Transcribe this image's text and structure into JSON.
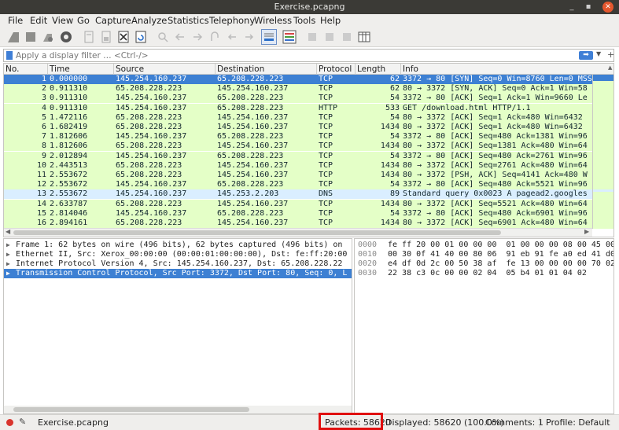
{
  "window": {
    "title": "Exercise.pcapng",
    "min": "_",
    "max": "▪",
    "close": "✕"
  },
  "menu": [
    "File",
    "Edit",
    "View",
    "Go",
    "Capture",
    "Analyze",
    "Statistics",
    "Telephony",
    "Wireless",
    "Tools",
    "Help"
  ],
  "filter": {
    "placeholder": "Apply a display filter … <Ctrl-/>"
  },
  "columns": [
    "No.",
    "Time",
    "Source",
    "Destination",
    "Protocol",
    "Length",
    "Info"
  ],
  "packets": [
    {
      "no": "1",
      "time": "0.000000",
      "src": "145.254.160.237",
      "dst": "65.208.228.223",
      "proto": "TCP",
      "len": "62",
      "info": "3372 → 80 [SYN] Seq=0 Win=8760 Len=0 MSS",
      "cls": "sel"
    },
    {
      "no": "2",
      "time": "0.911310",
      "src": "65.208.228.223",
      "dst": "145.254.160.237",
      "proto": "TCP",
      "len": "62",
      "info": "80 → 3372 [SYN, ACK] Seq=0 Ack=1 Win=58",
      "cls": "tcp"
    },
    {
      "no": "3",
      "time": "0.911310",
      "src": "145.254.160.237",
      "dst": "65.208.228.223",
      "proto": "TCP",
      "len": "54",
      "info": "3372 → 80 [ACK] Seq=1 Ack=1 Win=9660 Le",
      "cls": "tcp"
    },
    {
      "no": "4",
      "time": "0.911310",
      "src": "145.254.160.237",
      "dst": "65.208.228.223",
      "proto": "HTTP",
      "len": "533",
      "info": "GET /download.html HTTP/1.1",
      "cls": "http"
    },
    {
      "no": "5",
      "time": "1.472116",
      "src": "65.208.228.223",
      "dst": "145.254.160.237",
      "proto": "TCP",
      "len": "54",
      "info": "80 → 3372 [ACK] Seq=1 Ack=480 Win=6432",
      "cls": "tcp"
    },
    {
      "no": "6",
      "time": "1.682419",
      "src": "65.208.228.223",
      "dst": "145.254.160.237",
      "proto": "TCP",
      "len": "1434",
      "info": "80 → 3372 [ACK] Seq=1 Ack=480 Win=6432",
      "cls": "tcp"
    },
    {
      "no": "7",
      "time": "1.812606",
      "src": "145.254.160.237",
      "dst": "65.208.228.223",
      "proto": "TCP",
      "len": "54",
      "info": "3372 → 80 [ACK] Seq=480 Ack=1381 Win=96",
      "cls": "tcp"
    },
    {
      "no": "8",
      "time": "1.812606",
      "src": "65.208.228.223",
      "dst": "145.254.160.237",
      "proto": "TCP",
      "len": "1434",
      "info": "80 → 3372 [ACK] Seq=1381 Ack=480 Win=64",
      "cls": "tcp"
    },
    {
      "no": "9",
      "time": "2.012894",
      "src": "145.254.160.237",
      "dst": "65.208.228.223",
      "proto": "TCP",
      "len": "54",
      "info": "3372 → 80 [ACK] Seq=480 Ack=2761 Win=96",
      "cls": "tcp"
    },
    {
      "no": "10",
      "time": "2.443513",
      "src": "65.208.228.223",
      "dst": "145.254.160.237",
      "proto": "TCP",
      "len": "1434",
      "info": "80 → 3372 [ACK] Seq=2761 Ack=480 Win=64",
      "cls": "tcp"
    },
    {
      "no": "11",
      "time": "2.553672",
      "src": "65.208.228.223",
      "dst": "145.254.160.237",
      "proto": "TCP",
      "len": "1434",
      "info": "80 → 3372 [PSH, ACK] Seq=4141 Ack=480 W",
      "cls": "tcp"
    },
    {
      "no": "12",
      "time": "2.553672",
      "src": "145.254.160.237",
      "dst": "65.208.228.223",
      "proto": "TCP",
      "len": "54",
      "info": "3372 → 80 [ACK] Seq=480 Ack=5521 Win=96",
      "cls": "tcp"
    },
    {
      "no": "13",
      "time": "2.553672",
      "src": "145.254.160.237",
      "dst": "145.253.2.203",
      "proto": "DNS",
      "len": "89",
      "info": "Standard query 0x0023 A pagead2.googles",
      "cls": "dns"
    },
    {
      "no": "14",
      "time": "2.633787",
      "src": "65.208.228.223",
      "dst": "145.254.160.237",
      "proto": "TCP",
      "len": "1434",
      "info": "80 → 3372 [ACK] Seq=5521 Ack=480 Win=64",
      "cls": "tcp"
    },
    {
      "no": "15",
      "time": "2.814046",
      "src": "145.254.160.237",
      "dst": "65.208.228.223",
      "proto": "TCP",
      "len": "54",
      "info": "3372 → 80 [ACK] Seq=480 Ack=6901 Win=96",
      "cls": "tcp"
    },
    {
      "no": "16",
      "time": "2.894161",
      "src": "65.208.228.223",
      "dst": "145.254.160.237",
      "proto": "TCP",
      "len": "1434",
      "info": "80 → 3372 [ACK] Seq=6901 Ack=480 Win=64",
      "cls": "tcp"
    }
  ],
  "details": [
    {
      "text": "Frame 1: 62 bytes on wire (496 bits), 62 bytes captured (496 bits) on",
      "sel": false
    },
    {
      "text": "Ethernet II, Src: Xerox_00:00:00 (00:00:01:00:00:00), Dst: fe:ff:20:00",
      "sel": false
    },
    {
      "text": "Internet Protocol Version 4, Src: 145.254.160.237, Dst: 65.208.228.22",
      "sel": false
    },
    {
      "text": "Transmission Control Protocol, Src Port: 3372, Dst Port: 80, Seq: 0, L",
      "sel": true
    }
  ],
  "bytes": [
    {
      "off": "0000",
      "hex": "fe ff 20 00 01 00 00 00  01 00 00 00 08 00 45 00"
    },
    {
      "off": "0010",
      "hex": "00 30 0f 41 40 00 80 06  91 eb 91 fe a0 ed 41 d0"
    },
    {
      "off": "0020",
      "hex": "e4 df 0d 2c 00 50 38 af  fe 13 00 00 00 00 70 02"
    },
    {
      "off": "0030",
      "hex": "22 38 c3 0c 00 00 02 04  05 b4 01 01 04 02"
    }
  ],
  "status": {
    "file": "Exercise.pcapng",
    "packets": "Packets: 58620",
    "displayed": "Displayed: 58620 (100.0%)",
    "comments": "Comments: 1",
    "profile": "Profile: Default"
  },
  "colors": {
    "selected": "#3d80d3",
    "tcp": "#e4ffc7",
    "dns": "#daeeff",
    "highlight": "#e01010"
  }
}
